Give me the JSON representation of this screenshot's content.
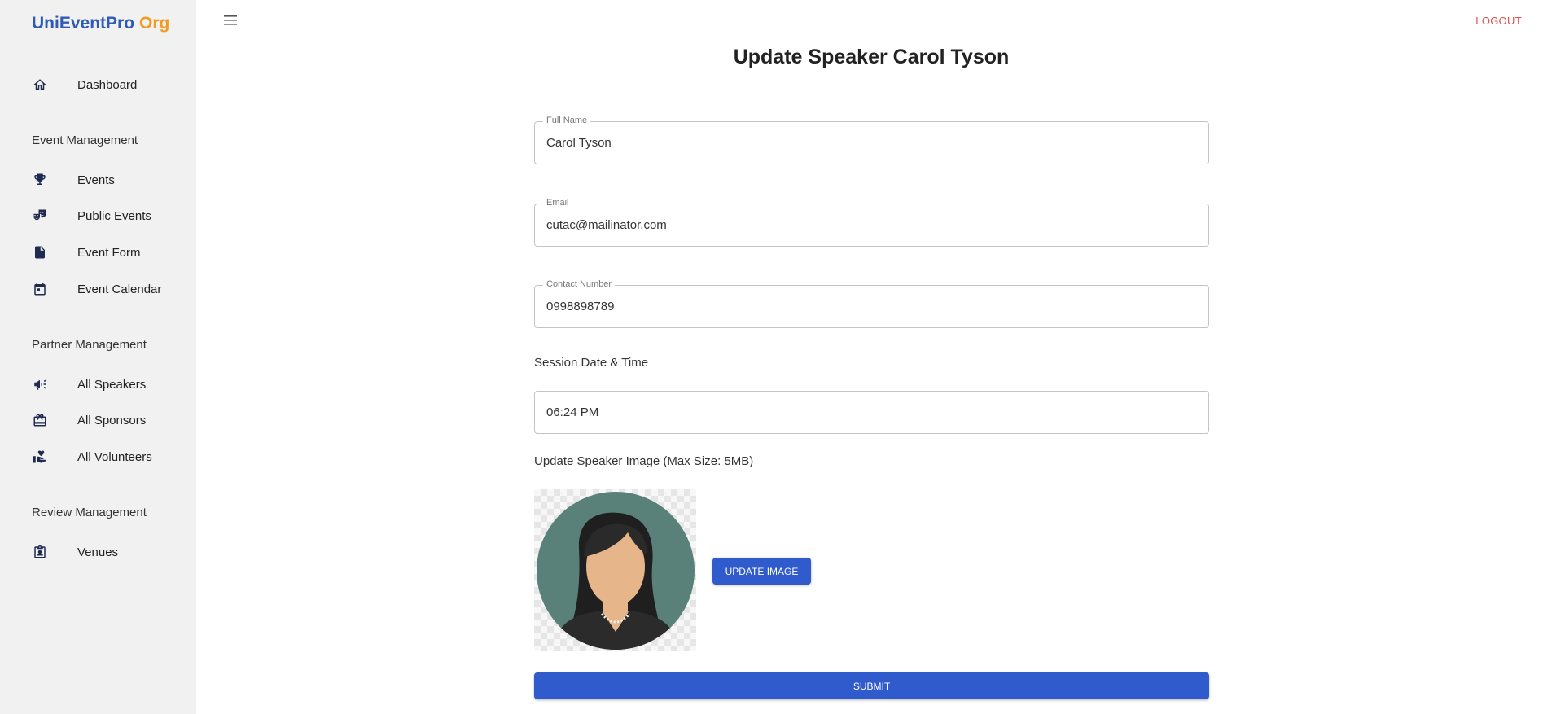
{
  "brand": {
    "name_part1": "UniEventPro",
    "name_part2": "Org",
    "color1": "#2f5bb7",
    "color2": "#f39a24"
  },
  "sidebar": {
    "dashboard": {
      "label": "Dashboard",
      "icon": "home-icon"
    },
    "sections": [
      {
        "title": "Event Management",
        "items": [
          {
            "label": "Events",
            "icon": "trophy-icon"
          },
          {
            "label": "Public Events",
            "icon": "theater-masks-icon"
          },
          {
            "label": "Event Form",
            "icon": "file-icon"
          },
          {
            "label": "Event Calendar",
            "icon": "calendar-icon"
          }
        ]
      },
      {
        "title": "Partner Management",
        "items": [
          {
            "label": "All Speakers",
            "icon": "megaphone-icon"
          },
          {
            "label": "All Sponsors",
            "icon": "gift-icon"
          },
          {
            "label": "All Volunteers",
            "icon": "hand-heart-icon"
          }
        ]
      },
      {
        "title": "Review Management",
        "items": [
          {
            "label": "Venues",
            "icon": "id-badge-icon"
          }
        ]
      }
    ]
  },
  "header": {
    "menu_icon": "hamburger-icon",
    "logout_label": "LOGOUT",
    "logout_color": "#d9534f"
  },
  "form": {
    "title": "Update Speaker Carol Tyson",
    "full_name": {
      "label": "Full Name",
      "value": "Carol Tyson"
    },
    "email": {
      "label": "Email",
      "value": "cutac@mailinator.com"
    },
    "contact": {
      "label": "Contact Number",
      "value": "0998898789"
    },
    "session_label": "Session Date & Time",
    "session_value": "06:24 PM",
    "image_label": "Update Speaker Image (Max Size: 5MB)",
    "update_image_button": "UPDATE IMAGE",
    "submit_button": "SUBMIT",
    "accent_color": "#2f5bcc"
  }
}
